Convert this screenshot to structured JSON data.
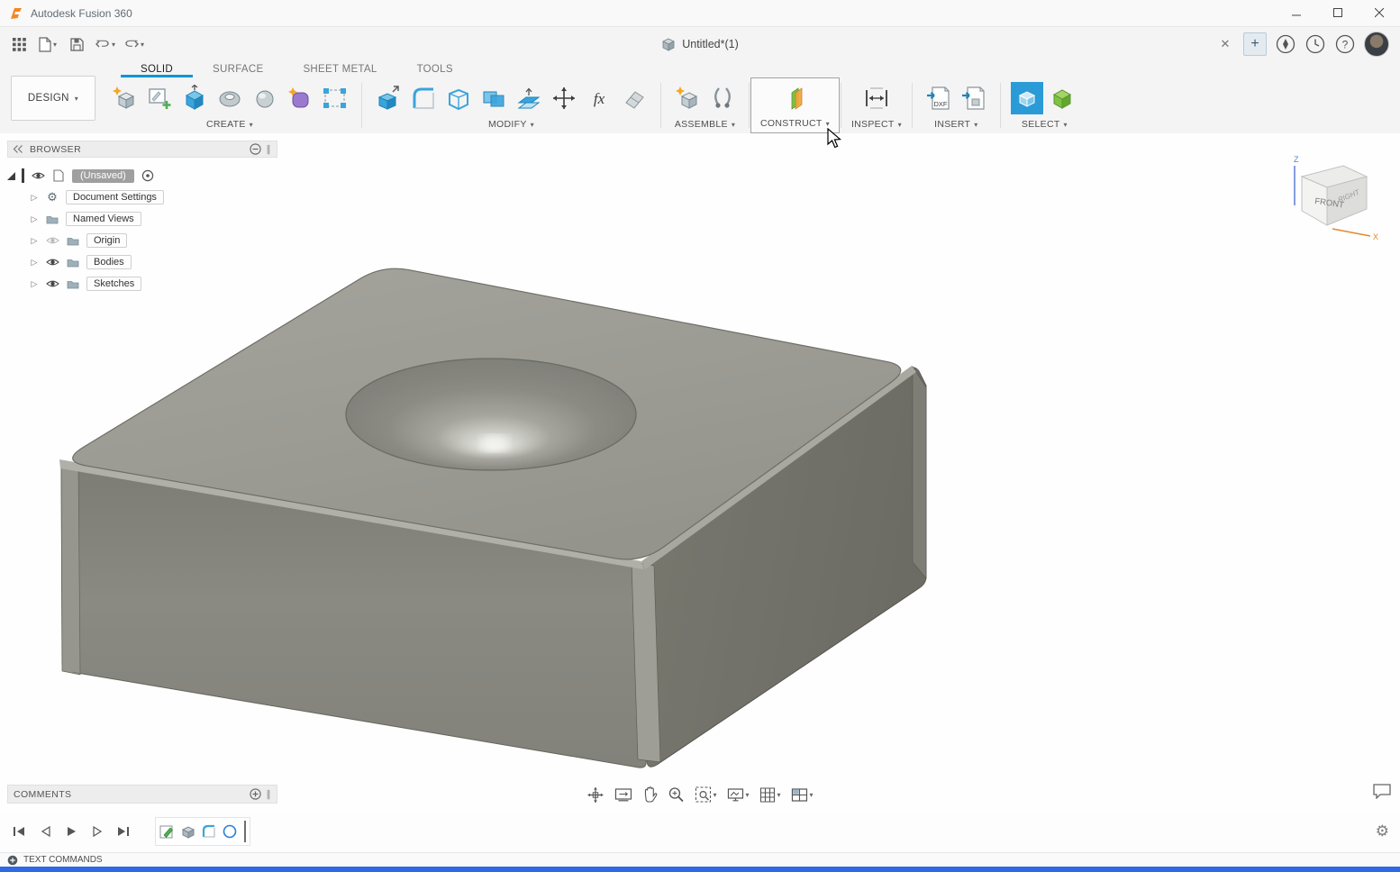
{
  "titlebar": {
    "app_title": "Autodesk Fusion 360"
  },
  "quickbar": {
    "document_tab_label": "Untitled*(1)",
    "new_tab_glyph": "+"
  },
  "ribbon": {
    "design_label": "DESIGN",
    "tabs": [
      {
        "label": "SOLID"
      },
      {
        "label": "SURFACE"
      },
      {
        "label": "SHEET METAL"
      },
      {
        "label": "TOOLS"
      }
    ],
    "groups": {
      "create": "CREATE",
      "modify": "MODIFY",
      "assemble": "ASSEMBLE",
      "construct": "CONSTRUCT",
      "inspect": "INSPECT",
      "insert": "INSERT",
      "select": "SELECT"
    },
    "insert_dxf_label": "DXF",
    "parameters_label": "fx"
  },
  "browser": {
    "header_label": "BROWSER",
    "root_label": "(Unsaved)",
    "items": [
      "Document Settings",
      "Named Views",
      "Origin",
      "Bodies",
      "Sketches"
    ]
  },
  "viewcube": {
    "front": "FRONT",
    "right": "RIGHT",
    "z": "Z",
    "x": "X"
  },
  "comments": {
    "header_label": "COMMENTS"
  },
  "statusbar": {
    "label": "TEXT COMMANDS"
  },
  "colors": {
    "accent_blue": "#0696d7",
    "taskbar_blue": "#2d6ae3",
    "model_top": "#9c9c96",
    "model_left": "#85857f",
    "model_right": "#70706a",
    "construct_green": "#7dc242",
    "construct_orange": "#f0a63c"
  }
}
